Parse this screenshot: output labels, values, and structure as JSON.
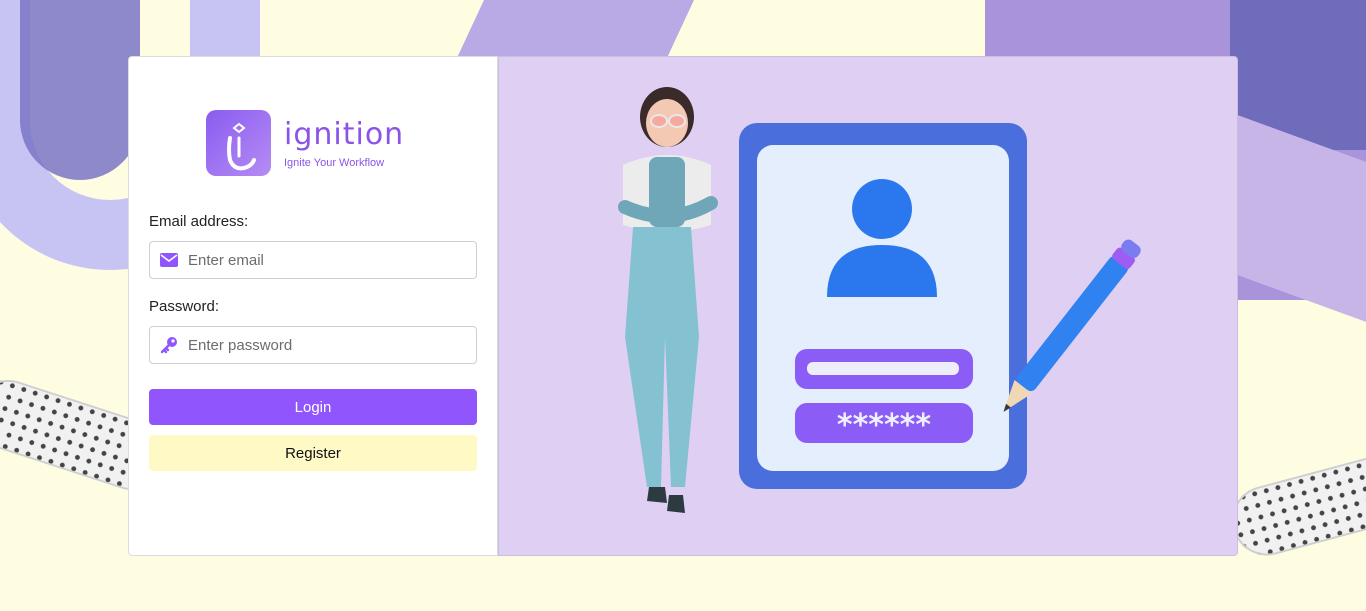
{
  "brand": {
    "name": "ignition",
    "tagline": "Ignite Your Workflow"
  },
  "form": {
    "email_label": "Email address:",
    "email_placeholder": "Enter email",
    "password_label": "Password:",
    "password_placeholder": "Enter password",
    "login_label": "Login",
    "register_label": "Register"
  },
  "illustration": {
    "password_mask": "******"
  },
  "colors": {
    "accent": "#9155fd",
    "register_bg": "#fff9c6",
    "panel_bg": "#dfd0f3",
    "page_bg": "#fefde2"
  },
  "icons": {
    "email": "envelope-icon",
    "password": "key-icon"
  }
}
